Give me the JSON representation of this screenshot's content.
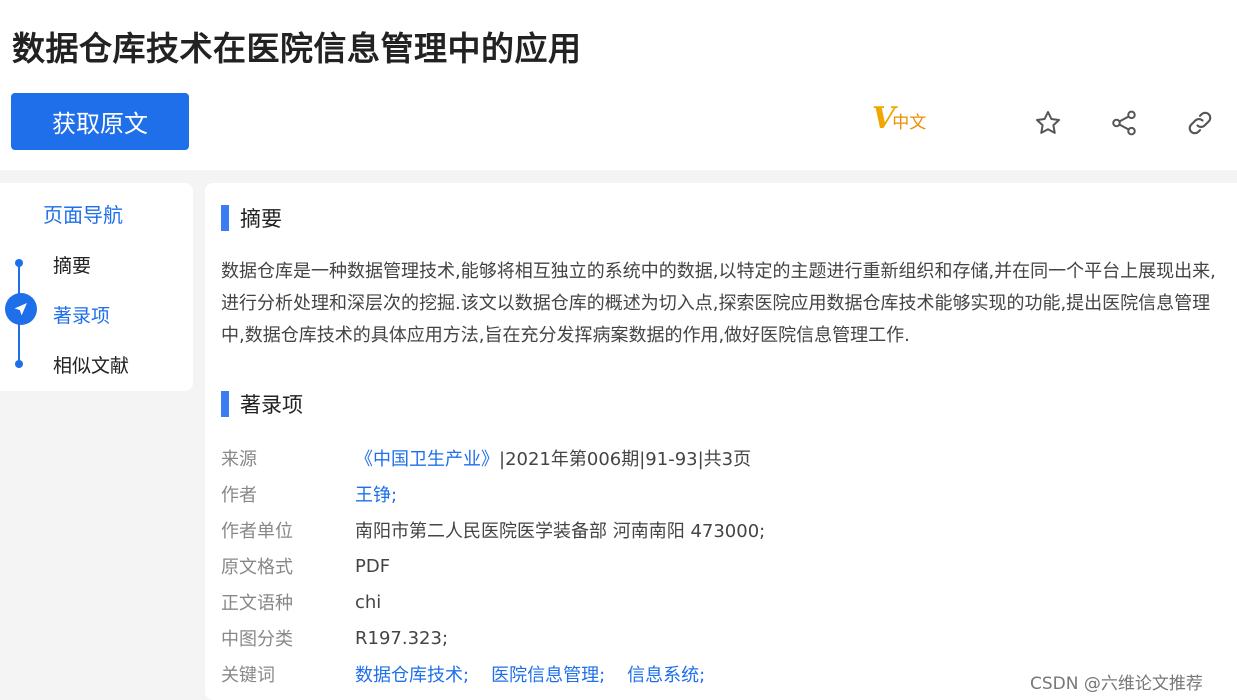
{
  "title": "数据仓库技术在医院信息管理中的应用",
  "actions": {
    "get_original": "获取原文",
    "language_logo": {
      "v": "V",
      "text": "中文"
    }
  },
  "icons": {
    "favorite": "star-icon",
    "share": "share-icon",
    "link": "link-icon"
  },
  "nav": {
    "title": "页面导航",
    "items": [
      {
        "label": "摘要",
        "active": false
      },
      {
        "label": "著录项",
        "active": true
      },
      {
        "label": "相似文献",
        "active": false
      }
    ]
  },
  "abstract": {
    "heading": "摘要",
    "text": "数据仓库是一种数据管理技术,能够将相互独立的系统中的数据,以特定的主题进行重新组织和存储,并在同一个平台上展现出来,进行分析处理和深层次的挖掘.该文以数据仓库的概述为切入点,探索医院应用数据仓库技术能够实现的功能,提出医院信息管理中,数据仓库技术的具体应用方法,旨在充分发挥病案数据的作用,做好医院信息管理工作."
  },
  "record": {
    "heading": "著录项",
    "source": {
      "label": "来源",
      "journal": "《中国卫生产业》",
      "detail": "|2021年第006期|91-93|共3页"
    },
    "author": {
      "label": "作者",
      "value": "王铮;"
    },
    "affiliation": {
      "label": "作者单位",
      "value": "南阳市第二人民医院医学装备部 河南南阳 473000;"
    },
    "format": {
      "label": "原文格式",
      "value": "PDF"
    },
    "language": {
      "label": "正文语种",
      "value": "chi"
    },
    "clc": {
      "label": "中图分类",
      "value": "R197.323;"
    },
    "keywords": {
      "label": "关键词",
      "values": [
        "数据仓库技术;",
        "医院信息管理;",
        "信息系统;"
      ]
    }
  },
  "watermark": "CSDN @六维论文推荐",
  "colors": {
    "accent": "#1f6feb",
    "logo": "#f0a800"
  }
}
